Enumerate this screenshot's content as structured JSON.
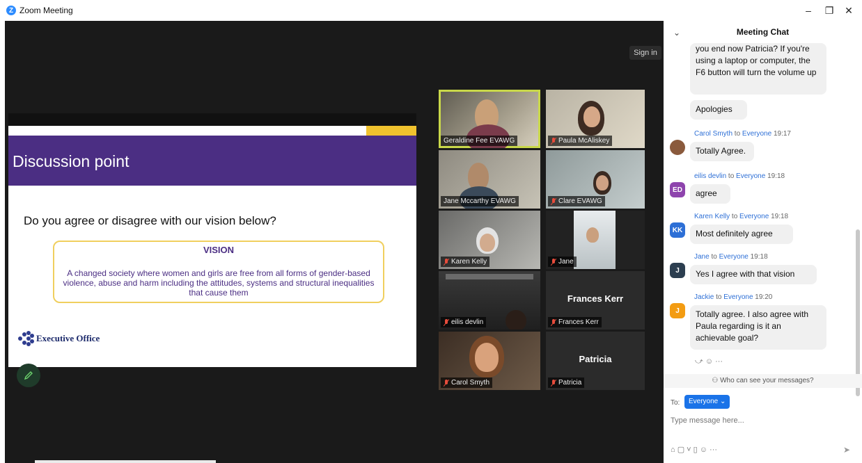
{
  "window": {
    "title": "Zoom Meeting",
    "logo_letter": "Z",
    "minimize": "–",
    "maximize": "❐",
    "close": "✕"
  },
  "meeting": {
    "signin_label": "Sign in"
  },
  "slide": {
    "heading": "Discussion point",
    "question": "Do you agree or disagree with our vision below?",
    "vision_title": "VISION",
    "vision_text": "A changed society where women and girls are free from all forms of gender-based violence, abuse and harm including the attitudes, systems and structural inequalities that cause them",
    "org_name": "Executive Office",
    "colors": {
      "purple": "#4b2e83",
      "gold": "#f0c22e"
    }
  },
  "participants": [
    {
      "name": "Geraldine Fee EVAWG",
      "muted": false,
      "video": true,
      "active": true
    },
    {
      "name": "Paula McAliskey",
      "muted": true,
      "video": true
    },
    {
      "name": "Jane Mccarthy EVAWG",
      "muted": false,
      "video": true
    },
    {
      "name": "Clare EVAWG",
      "muted": true,
      "video": true
    },
    {
      "name": "Karen Kelly",
      "muted": true,
      "video": true
    },
    {
      "name": "Jane",
      "muted": true,
      "video": true
    },
    {
      "name": "eilis devlin",
      "muted": true,
      "video": true
    },
    {
      "name": "Frances Kerr",
      "muted": true,
      "video": false,
      "display_name": "Frances Kerr"
    },
    {
      "name": "Carol Smyth",
      "muted": true,
      "video": true
    },
    {
      "name": "Patricia",
      "muted": true,
      "video": false,
      "display_name": "Patricia"
    }
  ],
  "chat": {
    "title": "Meeting Chat",
    "collapse_icon": "⌄",
    "messages": [
      {
        "text": "you end now Patricia? If you're using a laptop or computer, the F6 button will turn the volume up"
      },
      {
        "text": "Apologies"
      },
      {
        "sender": "Carol Smyth",
        "to": "to",
        "recipient": "Everyone",
        "time": "19:17",
        "text": "Totally Agree.",
        "avatar_color": "#8a5a3c"
      },
      {
        "sender": "eilis devlin",
        "to": "to",
        "recipient": "Everyone",
        "time": "19:18",
        "text": "agree",
        "initials": "ED",
        "avatar_color": "#8e44ad"
      },
      {
        "sender": "Karen Kelly",
        "to": "to",
        "recipient": "Everyone",
        "time": "19:18",
        "text": "Most definitely agree",
        "initials": "KK",
        "avatar_color": "#2d6fd6"
      },
      {
        "sender": "Jane",
        "to": "to",
        "recipient": "Everyone",
        "time": "19:18",
        "text": "Yes I agree with that vision",
        "initials": "J",
        "avatar_color": "#2c3e50"
      },
      {
        "sender": "Jackie",
        "to": "to",
        "recipient": "Everyone",
        "time": "19:20",
        "text": "Totally agree. I also agree with Paula regarding is it an achievable goal?",
        "initials": "J",
        "avatar_color": "#f39c12"
      }
    ],
    "reactions": "⤻  ☺  ···",
    "privacy_note": "Who can see your messages?",
    "to_label": "To:",
    "recipient_chip": "Everyone ⌄",
    "input_placeholder": "Type message here...",
    "toolbar": "⌂  ▢ ˅  ▯  ☺  ···",
    "send_icon": "➤"
  }
}
